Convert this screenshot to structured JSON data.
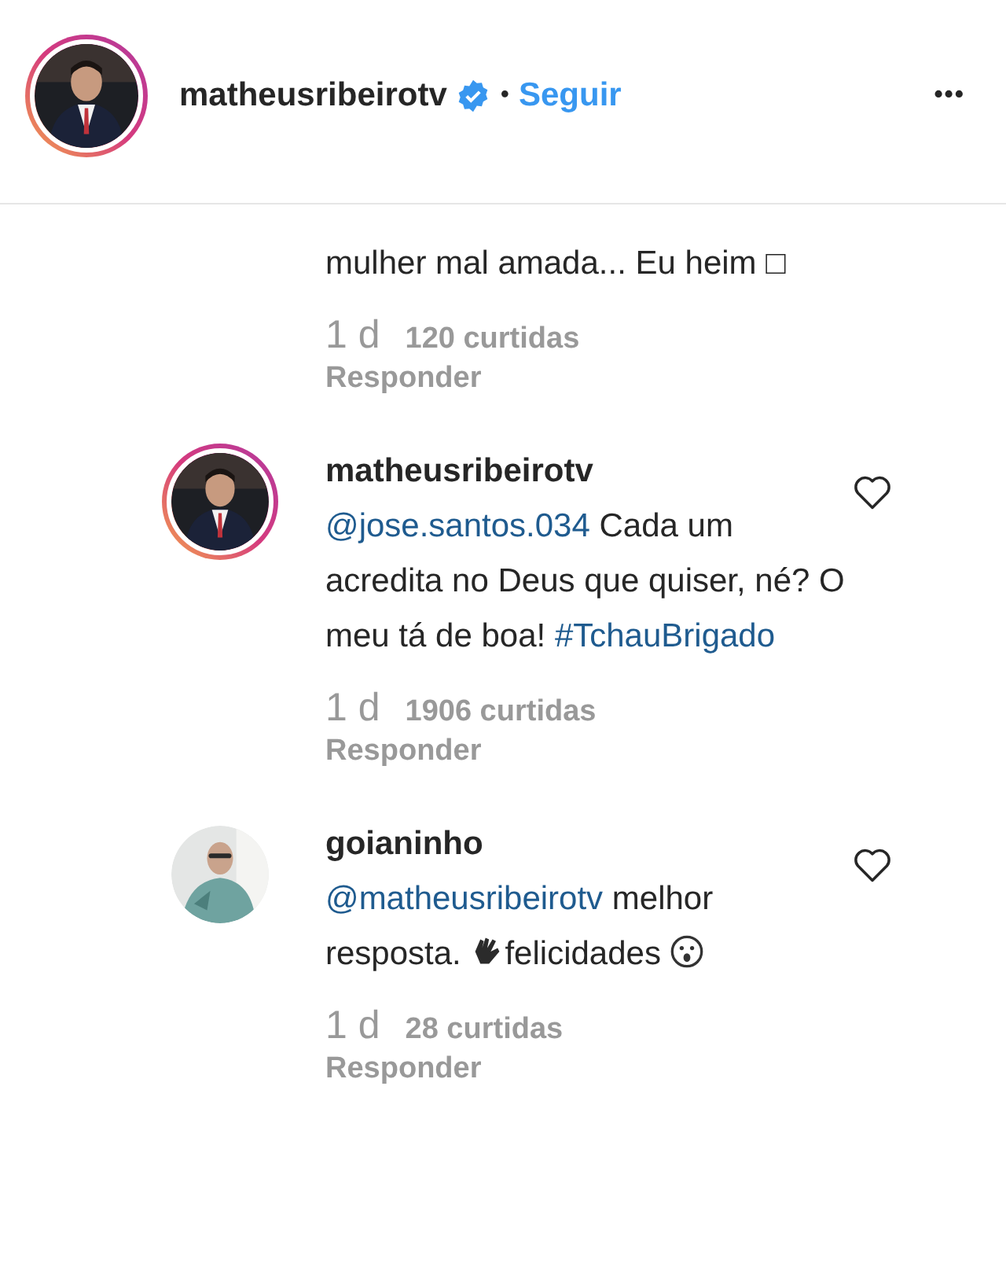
{
  "header": {
    "username": "matheusribeirotv",
    "verified": true,
    "separator": "•",
    "follow": "Seguir",
    "more": "•••"
  },
  "comments": [
    {
      "body": [
        {
          "kind": "text",
          "text": "mulher mal amada... Eu heim □"
        }
      ],
      "time": "1 d",
      "likes": "120 curtidas",
      "reply": "Responder"
    },
    {
      "story_ring": true,
      "username": "matheusribeirotv",
      "body": [
        {
          "kind": "mention",
          "text": "@jose.santos.034"
        },
        {
          "kind": "text",
          "text": " Cada um acredita no Deus que quiser, né? O meu tá de boa! "
        },
        {
          "kind": "hashtag",
          "text": "#TchauBrigado"
        }
      ],
      "time": "1 d",
      "likes": "1906 curtidas",
      "reply": "Responder"
    },
    {
      "story_ring": false,
      "username": "goianinho",
      "body": [
        {
          "kind": "mention",
          "text": "@matheusribeirotv"
        },
        {
          "kind": "text",
          "text": " melhor resposta. "
        },
        {
          "kind": "clap"
        },
        {
          "kind": "text",
          "text": "felicidades "
        },
        {
          "kind": "surprise"
        }
      ],
      "time": "1 d",
      "likes": "28 curtidas",
      "reply": "Responder"
    }
  ]
}
